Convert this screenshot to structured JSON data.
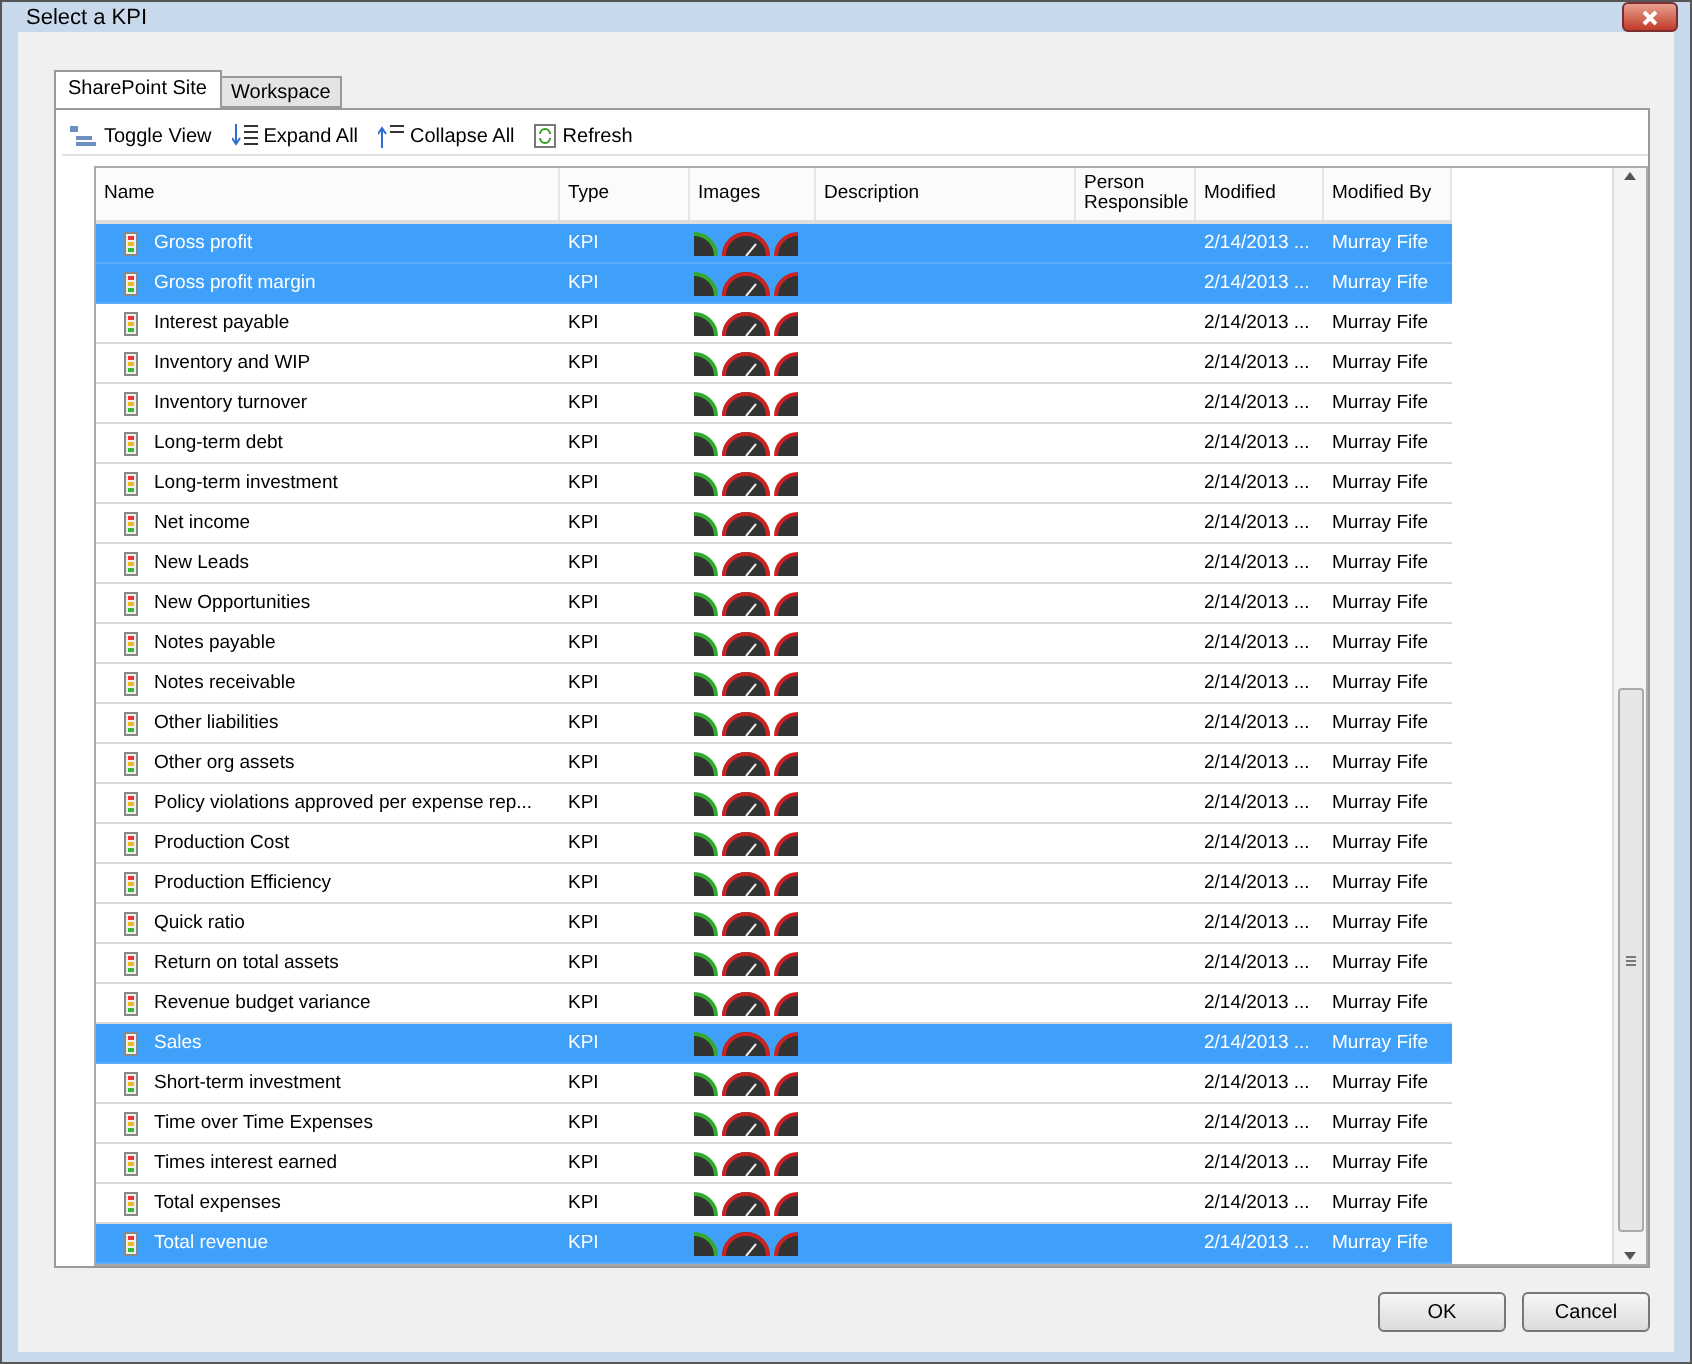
{
  "window": {
    "title": "Select a KPI"
  },
  "tabs": [
    {
      "label": "SharePoint Site",
      "selected": true
    },
    {
      "label": "Workspace",
      "selected": false
    }
  ],
  "toolbar": [
    {
      "kind": "toggle",
      "label": "Toggle View"
    },
    {
      "kind": "expand",
      "label": "Expand All"
    },
    {
      "kind": "collapse",
      "label": "Collapse All"
    },
    {
      "kind": "refresh",
      "label": "Refresh"
    }
  ],
  "table": {
    "columns": [
      "Name",
      "Type",
      "Images",
      "Description",
      "Person Responsible",
      "Modified",
      "Modified By"
    ],
    "rows": [
      {
        "name": "Gross profit",
        "type": "KPI",
        "modified": "2/14/2013 ...",
        "modified_by": "Murray Fife",
        "selected": true
      },
      {
        "name": "Gross profit margin",
        "type": "KPI",
        "modified": "2/14/2013 ...",
        "modified_by": "Murray Fife",
        "selected": true
      },
      {
        "name": "Interest payable",
        "type": "KPI",
        "modified": "2/14/2013 ...",
        "modified_by": "Murray Fife",
        "selected": false
      },
      {
        "name": "Inventory and WIP",
        "type": "KPI",
        "modified": "2/14/2013 ...",
        "modified_by": "Murray Fife",
        "selected": false
      },
      {
        "name": "Inventory turnover",
        "type": "KPI",
        "modified": "2/14/2013 ...",
        "modified_by": "Murray Fife",
        "selected": false
      },
      {
        "name": "Long-term debt",
        "type": "KPI",
        "modified": "2/14/2013 ...",
        "modified_by": "Murray Fife",
        "selected": false
      },
      {
        "name": "Long-term investment",
        "type": "KPI",
        "modified": "2/14/2013 ...",
        "modified_by": "Murray Fife",
        "selected": false
      },
      {
        "name": "Net income",
        "type": "KPI",
        "modified": "2/14/2013 ...",
        "modified_by": "Murray Fife",
        "selected": false
      },
      {
        "name": "New Leads",
        "type": "KPI",
        "modified": "2/14/2013 ...",
        "modified_by": "Murray Fife",
        "selected": false
      },
      {
        "name": "New Opportunities",
        "type": "KPI",
        "modified": "2/14/2013 ...",
        "modified_by": "Murray Fife",
        "selected": false
      },
      {
        "name": "Notes payable",
        "type": "KPI",
        "modified": "2/14/2013 ...",
        "modified_by": "Murray Fife",
        "selected": false
      },
      {
        "name": "Notes receivable",
        "type": "KPI",
        "modified": "2/14/2013 ...",
        "modified_by": "Murray Fife",
        "selected": false
      },
      {
        "name": "Other liabilities",
        "type": "KPI",
        "modified": "2/14/2013 ...",
        "modified_by": "Murray Fife",
        "selected": false
      },
      {
        "name": "Other org assets",
        "type": "KPI",
        "modified": "2/14/2013 ...",
        "modified_by": "Murray Fife",
        "selected": false
      },
      {
        "name": "Policy violations approved per expense rep...",
        "type": "KPI",
        "modified": "2/14/2013 ...",
        "modified_by": "Murray Fife",
        "selected": false
      },
      {
        "name": "Production Cost",
        "type": "KPI",
        "modified": "2/14/2013 ...",
        "modified_by": "Murray Fife",
        "selected": false
      },
      {
        "name": "Production Efficiency",
        "type": "KPI",
        "modified": "2/14/2013 ...",
        "modified_by": "Murray Fife",
        "selected": false
      },
      {
        "name": "Quick ratio",
        "type": "KPI",
        "modified": "2/14/2013 ...",
        "modified_by": "Murray Fife",
        "selected": false
      },
      {
        "name": "Return on total assets",
        "type": "KPI",
        "modified": "2/14/2013 ...",
        "modified_by": "Murray Fife",
        "selected": false
      },
      {
        "name": "Revenue budget variance",
        "type": "KPI",
        "modified": "2/14/2013 ...",
        "modified_by": "Murray Fife",
        "selected": false
      },
      {
        "name": "Sales",
        "type": "KPI",
        "modified": "2/14/2013 ...",
        "modified_by": "Murray Fife",
        "selected": true
      },
      {
        "name": "Short-term investment",
        "type": "KPI",
        "modified": "2/14/2013 ...",
        "modified_by": "Murray Fife",
        "selected": false
      },
      {
        "name": "Time over Time Expenses",
        "type": "KPI",
        "modified": "2/14/2013 ...",
        "modified_by": "Murray Fife",
        "selected": false
      },
      {
        "name": "Times interest earned",
        "type": "KPI",
        "modified": "2/14/2013 ...",
        "modified_by": "Murray Fife",
        "selected": false
      },
      {
        "name": "Total expenses",
        "type": "KPI",
        "modified": "2/14/2013 ...",
        "modified_by": "Murray Fife",
        "selected": false
      },
      {
        "name": "Total revenue",
        "type": "KPI",
        "modified": "2/14/2013 ...",
        "modified_by": "Murray Fife",
        "selected": true
      }
    ]
  },
  "buttons": [
    "OK",
    "Cancel"
  ]
}
